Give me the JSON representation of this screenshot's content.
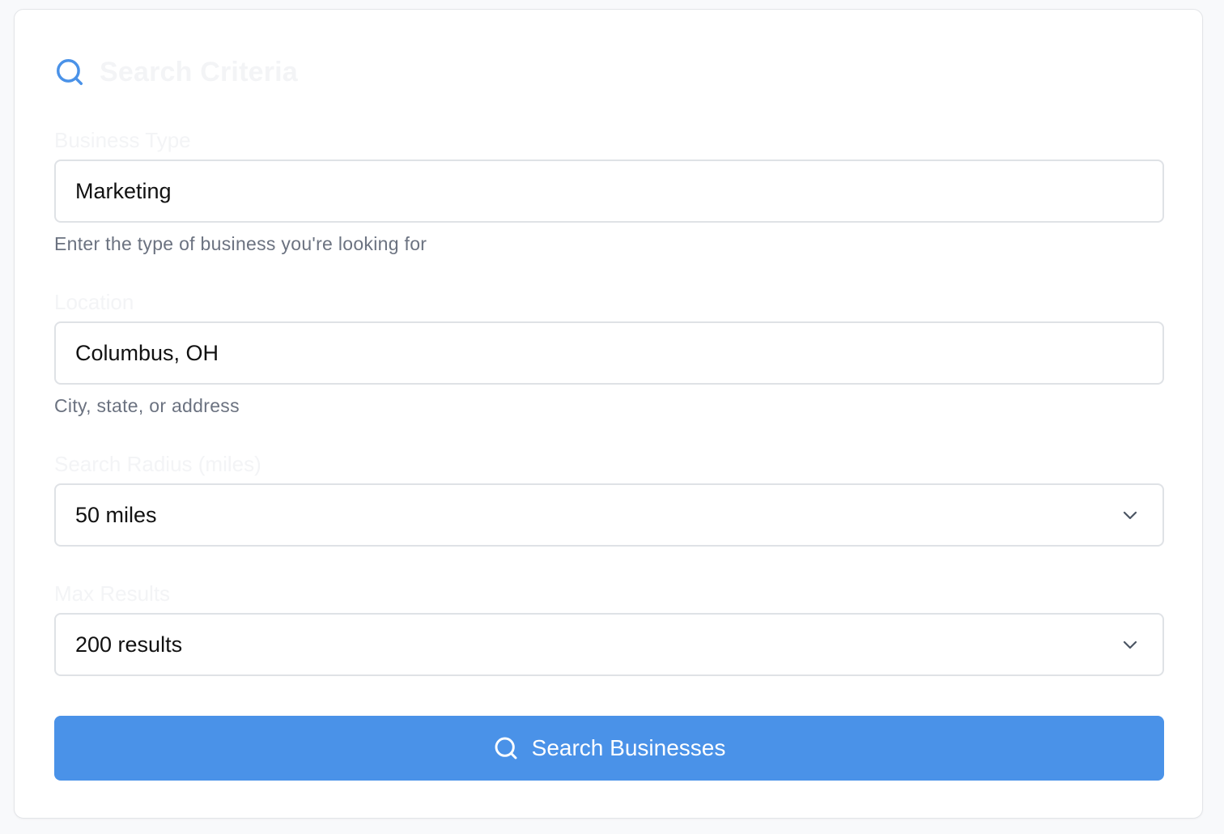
{
  "header": {
    "title": "Search Criteria",
    "icon": "search-icon",
    "icon_color": "#4a92e8"
  },
  "fields": {
    "business_type": {
      "label": "Business Type",
      "value": "Marketing",
      "hint": "Enter the type of business you're looking for"
    },
    "location": {
      "label": "Location",
      "value": "Columbus, OH",
      "hint": "City, state, or address"
    },
    "radius": {
      "label": "Search Radius (miles)",
      "selected": "50 miles",
      "icon": "chevron-down-icon"
    },
    "max_results": {
      "label": "Max Results",
      "selected": "200 results",
      "icon": "chevron-down-icon"
    }
  },
  "submit": {
    "label": "Search Businesses",
    "icon": "search-icon",
    "background": "#4a92e8"
  }
}
